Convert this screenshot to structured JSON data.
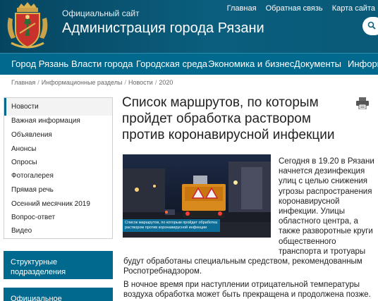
{
  "header": {
    "subtitle": "Официальный сайт",
    "title": "Администрация города Рязани",
    "links": [
      "Главная",
      "Обратная связь",
      "Карта сайта"
    ]
  },
  "nav": [
    "Город Рязань",
    "Власти города",
    "Городская среда",
    "Экономика и бизнес",
    "Документы",
    "Информа"
  ],
  "breadcrumb": [
    "Главная",
    "Информационные разделы",
    "Новости",
    "2020"
  ],
  "sidebar": {
    "items": [
      "Новости",
      "Важная информация",
      "Объявления",
      "Анонсы",
      "Опросы",
      "Фотогалерея",
      "Прямая речь",
      "Осенний месячник 2019",
      "Вопрос-ответ",
      "Видео"
    ],
    "block1": "Структурные подразделения администрации города Рязани",
    "block2": "Официальное опубликование"
  },
  "article": {
    "title": "Список маршрутов, по которым пройдет обработка раствором против коронавирусной инфекции",
    "photo_caption": "Список маршрутов, по которым пройдет обработка раствором против коронавирусной инфекции",
    "p1_side": [
      "Сегодня в 19.20 в Рязани",
      "начнется дезинфекция",
      "улиц с целью снижения",
      "угрозы распространения",
      "коронавирусной",
      "инфекции. Улицы",
      "областного центра, а",
      "также разворотные круги",
      "общественного",
      "транспорта и тротуары"
    ],
    "p1_full": [
      "будут обработаны специальным средством, рекомендованным",
      "Роспотребнадзором."
    ],
    "p2": [
      "В ночное время при наступлении отрицательной температуры",
      "воздуха обработка может быть прекращена и продолжена позже."
    ]
  },
  "colors": {
    "header": "#0b5e7e",
    "nav": "#00698d",
    "accent": "#00698d"
  }
}
